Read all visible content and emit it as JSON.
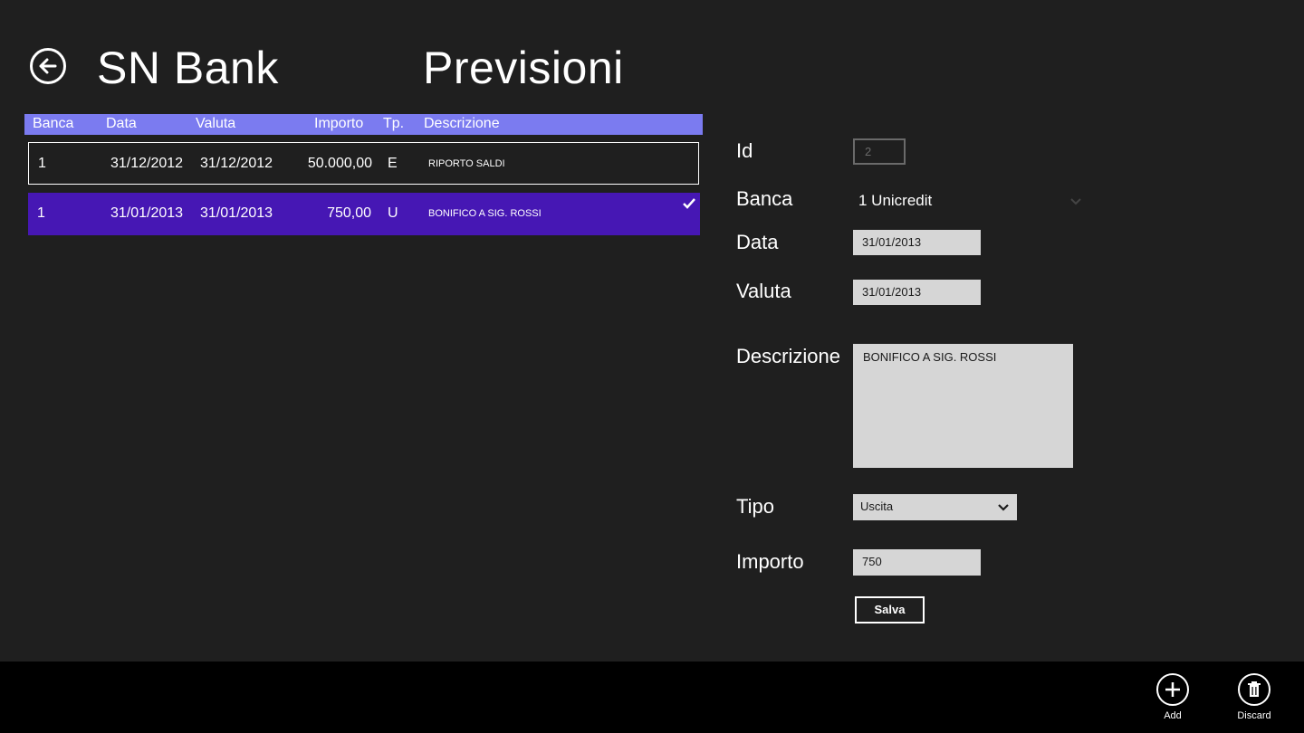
{
  "header": {
    "app_title": "SN Bank",
    "page_title": "Previsioni"
  },
  "list": {
    "columns": [
      "Banca",
      "Data",
      "Valuta",
      "Importo",
      "Tp.",
      "Descrizione"
    ],
    "rows": [
      {
        "banca": "1",
        "data": "31/12/2012",
        "valuta": "31/12/2012",
        "importo": "50.000,00",
        "tipo": "E",
        "descrizione": "RIPORTO SALDI",
        "selected": false
      },
      {
        "banca": "1",
        "data": "31/01/2013",
        "valuta": "31/01/2013",
        "importo": "750,00",
        "tipo": "U",
        "descrizione": "BONIFICO A SIG. ROSSI",
        "selected": true
      }
    ]
  },
  "form": {
    "id_label": "Id",
    "id_value": "2",
    "banca_label": "Banca",
    "banca_value": "1  Unicredit",
    "data_label": "Data",
    "data_value": "31/01/2013",
    "valuta_label": "Valuta",
    "valuta_value": "31/01/2013",
    "descrizione_label": "Descrizione",
    "descrizione_value": "BONIFICO A SIG. ROSSI",
    "tipo_label": "Tipo",
    "tipo_value": "Uscita",
    "importo_label": "Importo",
    "importo_value": "750",
    "save_label": "Salva"
  },
  "appbar": {
    "add_label": "Add",
    "discard_label": "Discard"
  },
  "colors": {
    "background": "#1f1f1f",
    "list_header": "#7b7bf0",
    "selected_row": "#4617b4",
    "field_bg": "#d6d6d6",
    "appbar": "#000000"
  }
}
